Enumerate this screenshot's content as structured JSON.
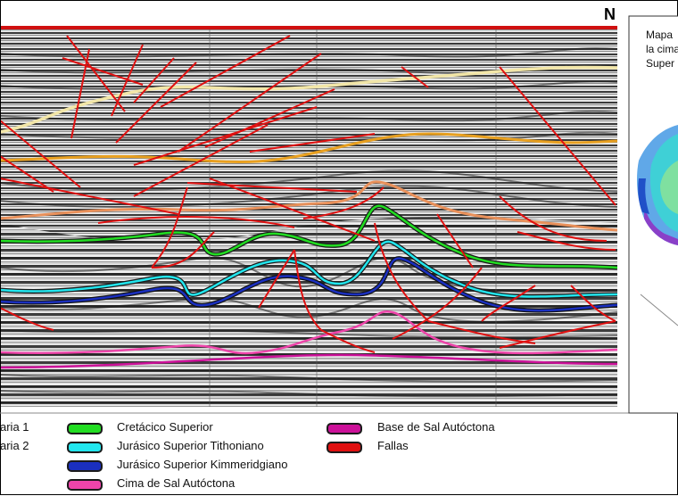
{
  "north_label": "N",
  "inset": {
    "title_lines": [
      "Mapa",
      "la cima",
      "Super"
    ]
  },
  "legend": {
    "col1": [
      {
        "label": "aria 1"
      },
      {
        "label": "aria 2"
      }
    ],
    "col2": [
      {
        "label": "Cretácico Superior",
        "color": "#22dd22"
      },
      {
        "label": "Jurásico Superior Tithoniano",
        "color": "#22e6ee"
      },
      {
        "label": "Jurásico Superior Kimmeridgiano",
        "color": "#1a2fbf"
      },
      {
        "label": "Cima de Sal Autóctona",
        "color": "#ee44aa"
      }
    ],
    "col3": [
      {
        "label": "Base de Sal Autóctona",
        "color": "#cc1199"
      },
      {
        "label": "Fallas",
        "color": "#e01010"
      }
    ]
  },
  "colors": {
    "frame": "#d01010",
    "terciaria1": "#f2e6a8",
    "terciaria2": "#e8a020",
    "mid_horizon": "#e8905a"
  }
}
